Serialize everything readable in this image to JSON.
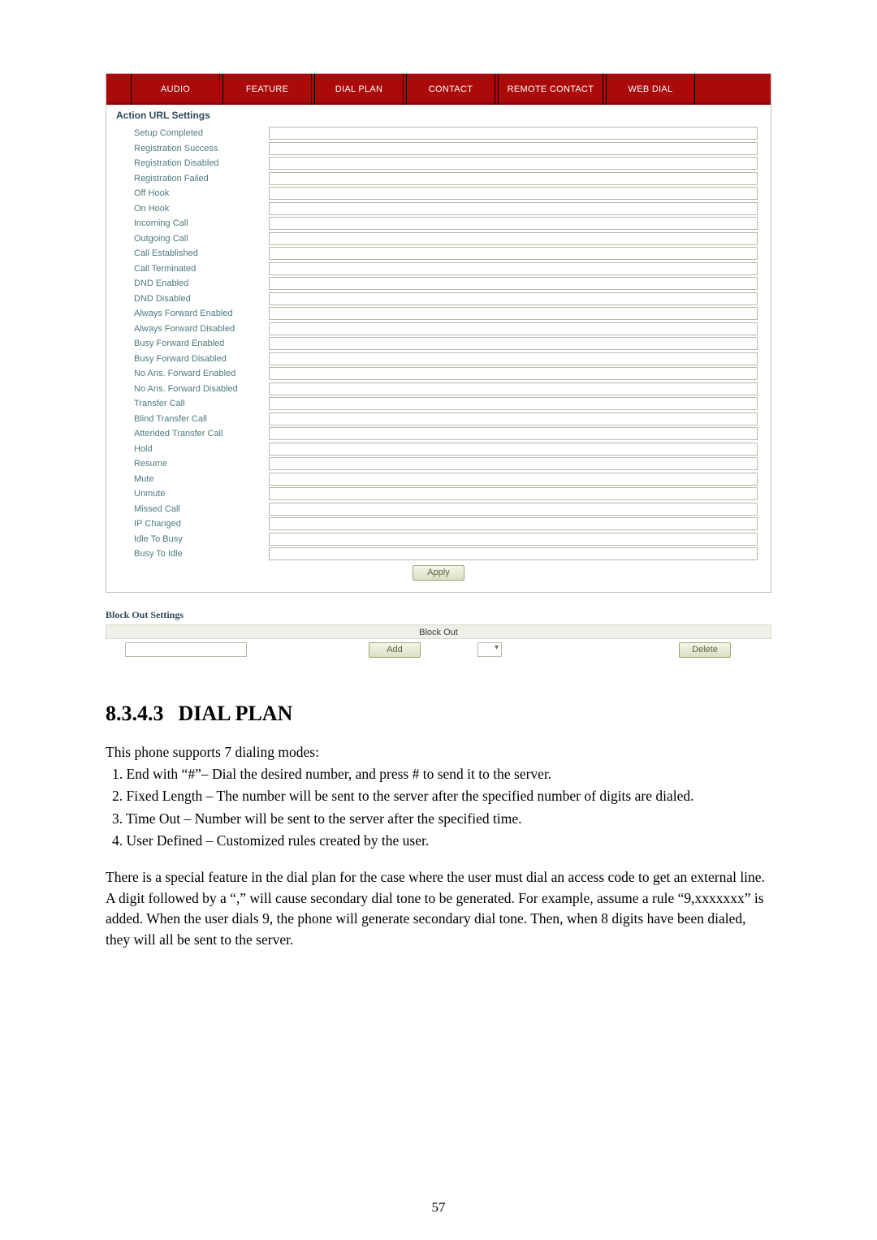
{
  "tabs": {
    "audio": "AUDIO",
    "feature": "FEATURE",
    "dial_plan": "DIAL PLAN",
    "contact": "CONTACT",
    "remote_contact": "REMOTE CONTACT",
    "web_dial": "WEB DIAL"
  },
  "section": {
    "action_url": "Action URL Settings",
    "block_out": "Block Out Settings",
    "block_caption": "Block Out"
  },
  "fields": [
    "Setup Completed",
    "Registration Success",
    "Registration Disabled",
    "Registration Failed",
    "Off Hook",
    "On Hook",
    "Incoming Call",
    "Outgoing Call",
    "Call Established",
    "Call Terminated",
    "DND Enabled",
    "DND Disabled",
    "Always Forward Enabled",
    "Always Forward Disabled",
    "Busy Forward Enabled",
    "Busy Forward Disabled",
    "No Ans. Forward Enabled",
    "No Ans. Forward Disabled",
    "Transfer Call",
    "Blind Transfer Call",
    "Attended Transfer Call",
    "Hold",
    "Resume",
    "Mute",
    "Unmute",
    "Missed Call",
    "IP Changed",
    "Idle To Busy",
    "Busy To Idle"
  ],
  "buttons": {
    "apply": "Apply",
    "add": "Add",
    "delete": "Delete"
  },
  "dropdown_glyph": "▾",
  "doc": {
    "heading_num": "8.3.4.3",
    "heading_txt": "DIAL PLAN",
    "intro": "This phone supports 7 dialing modes:",
    "li1": "1.   End with “#”– Dial the desired number, and press # to send it to the server.",
    "li2": "2.   Fixed Length – The number will be sent to the server after the specified number of digits are dialed.",
    "li3": "3.   Time Out – Number will be sent to the server after the specified time.",
    "li4": "4.   User Defined – Customized rules created by the user.",
    "para": "There is a special feature in the dial plan for the case where the user must dial an access code to get an external line.   A digit followed by a “,” will cause secondary dial tone to be generated.   For example, assume a rule “9,xxxxxxx” is added.   When the user dials 9, the phone will generate secondary dial tone.   Then, when 8 digits have been dialed, they will all be sent to the server.",
    "pageno": "57"
  }
}
